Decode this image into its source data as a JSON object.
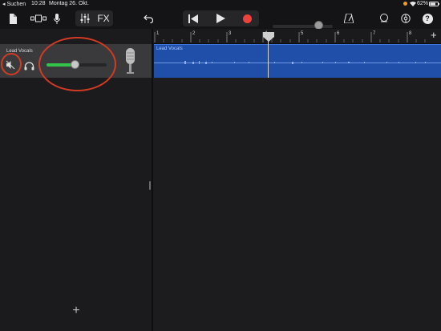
{
  "status_bar": {
    "back_label": "◂ Suchen",
    "time": "10:28",
    "date": "Montag 26. Okt.",
    "battery": "62%"
  },
  "toolbar": {
    "icons": [
      "document-icon",
      "browser-icon",
      "microphone-icon",
      "mixer-icon",
      "fx-label",
      "undo-icon",
      "rewind-icon",
      "play-icon",
      "record-icon",
      "metronome-icon",
      "loop-icon",
      "settings-icon",
      "help-icon"
    ],
    "fx_label": "FX",
    "help_label": "?",
    "accent_record": "#f0413b"
  },
  "track": {
    "name": "Lead Vocals",
    "volume_fraction": 0.45,
    "muted": true
  },
  "ruler": {
    "bars": [
      "1",
      "2",
      "3",
      "4",
      "5",
      "6",
      "7",
      "8"
    ],
    "add_label": "+"
  },
  "region": {
    "name": "Lead Vocals",
    "color": "#1f4fa8"
  },
  "add_track_label": "+"
}
